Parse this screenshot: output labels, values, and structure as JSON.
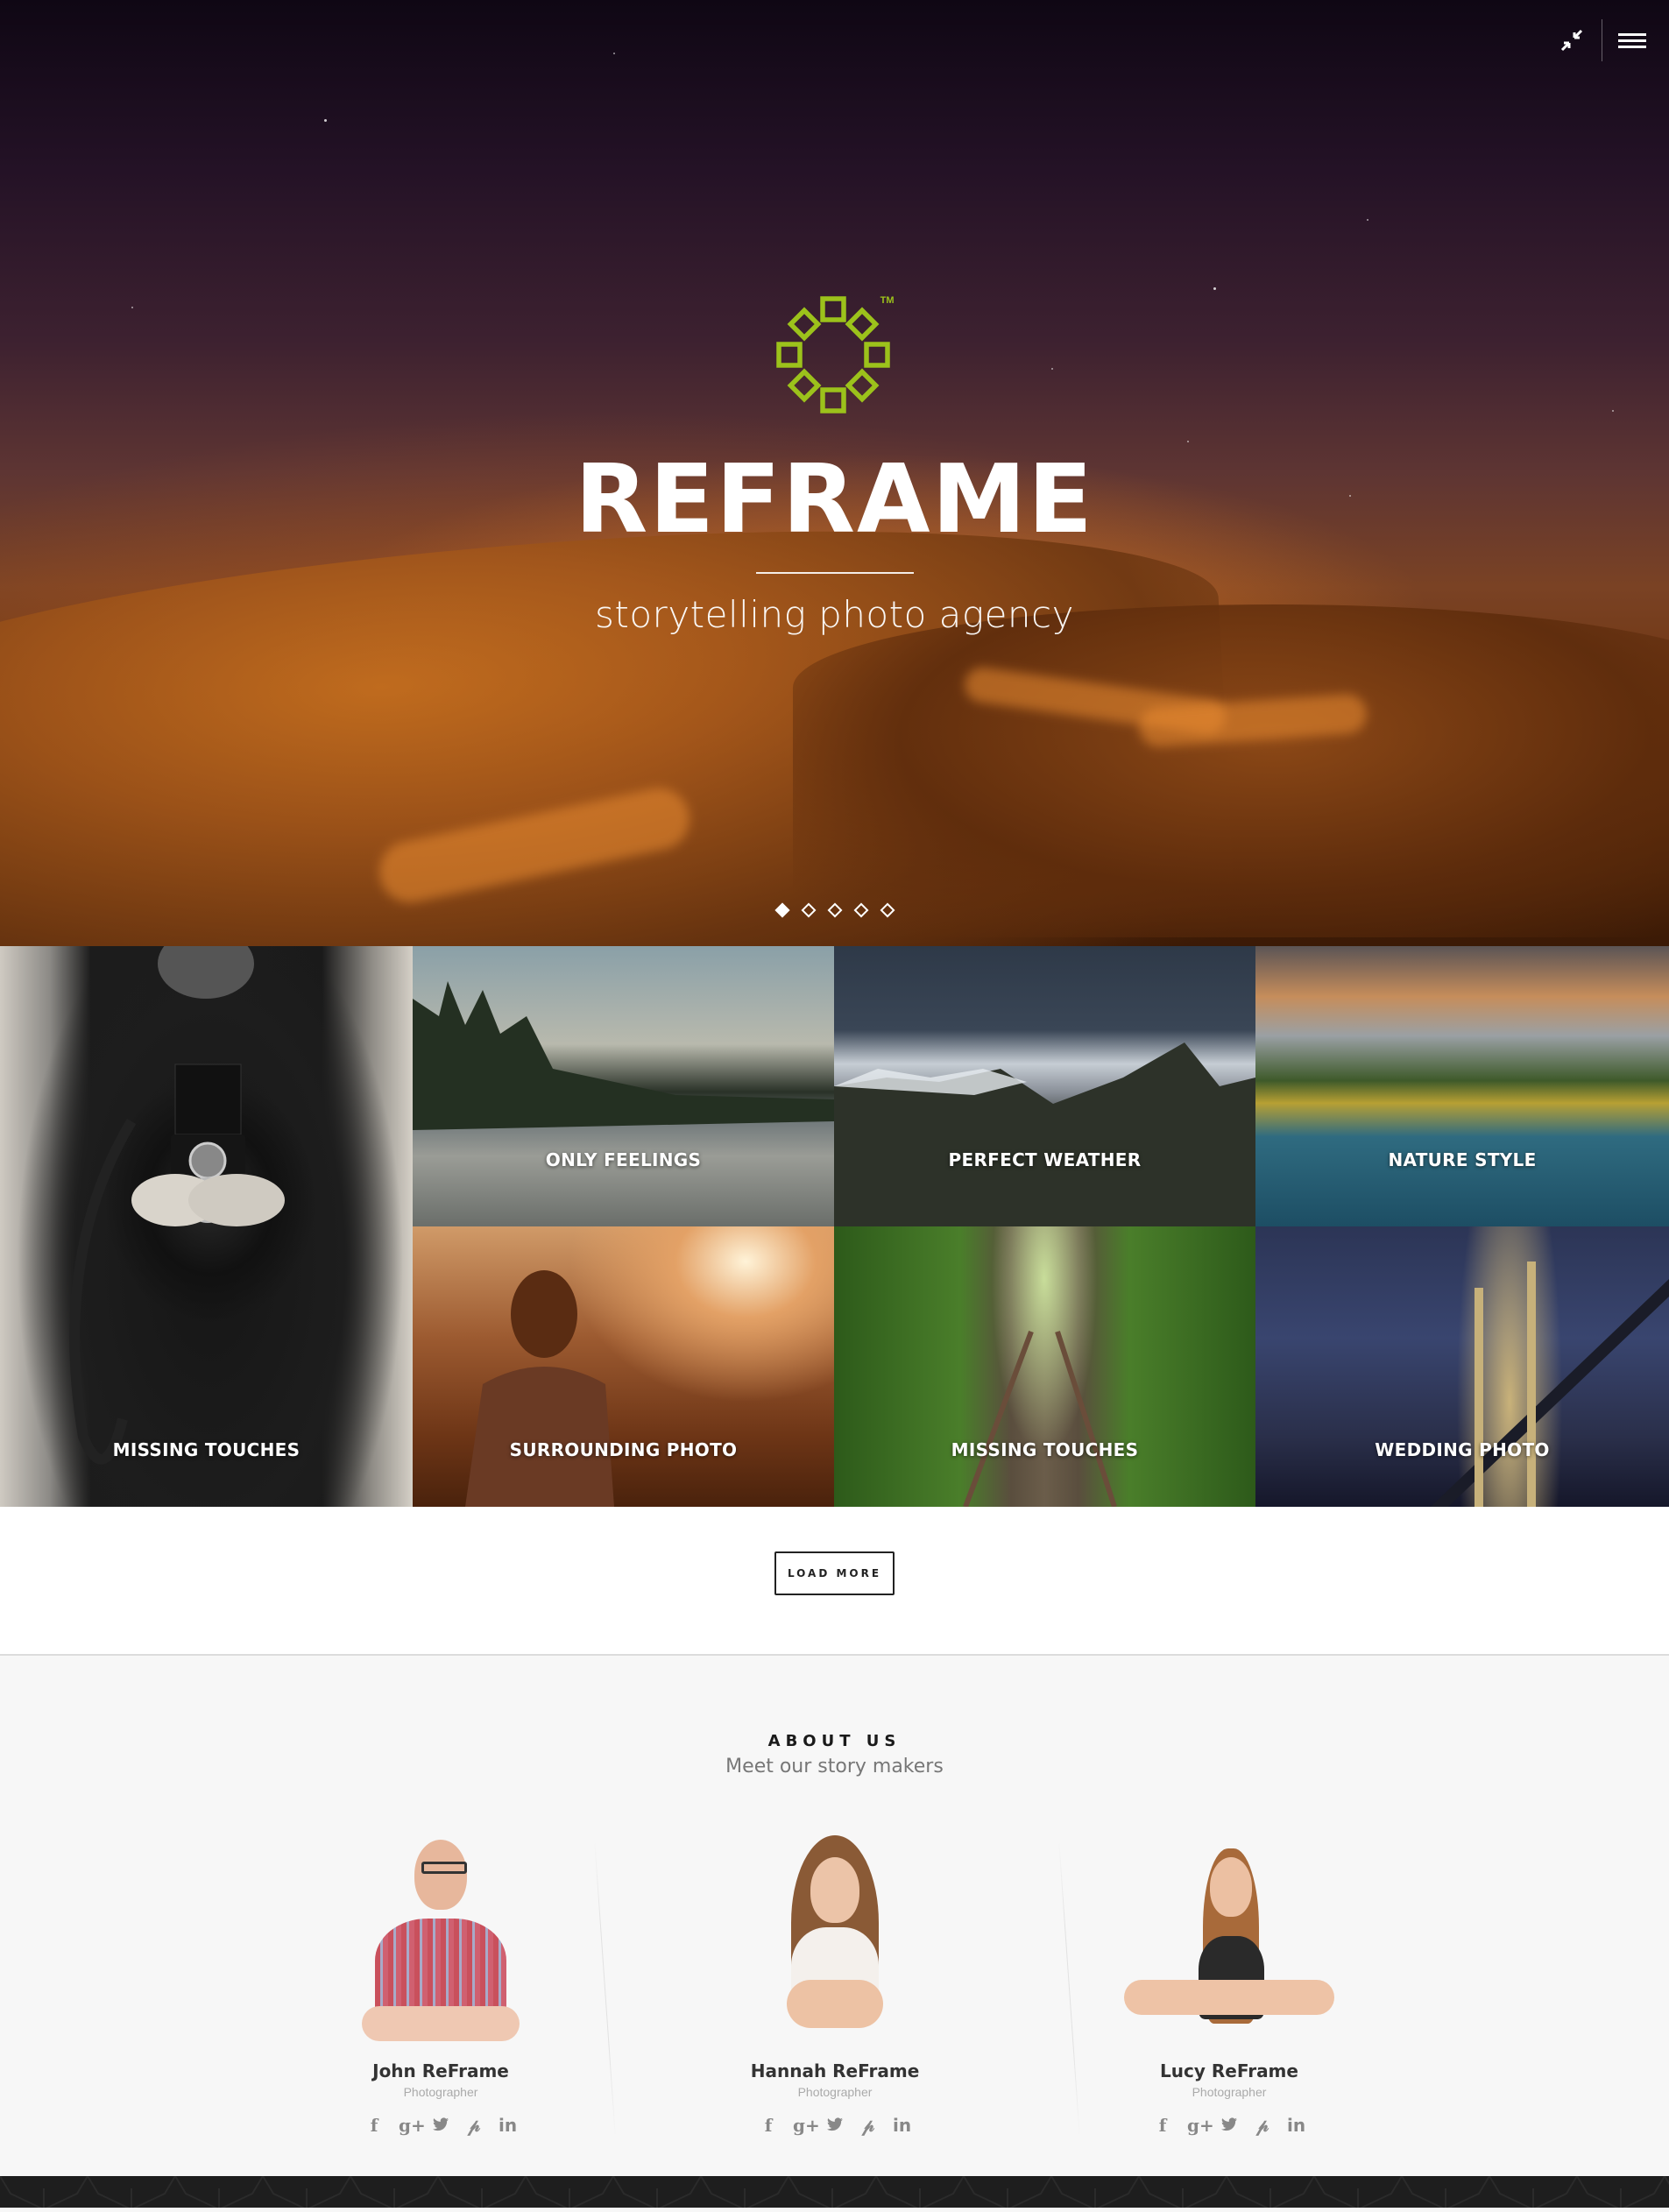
{
  "hero": {
    "brand_title": "REFRAME",
    "tagline": "storytelling photo agency",
    "logo_mark": "TM",
    "accent_color": "#9cc21b",
    "tools": {
      "collapse_icon": "collapse-arrows-icon",
      "menu_icon": "hamburger-menu-icon"
    },
    "slider": {
      "slide_count": 5,
      "active_index": 0
    }
  },
  "gallery": {
    "tiles": [
      {
        "caption": "MISSING TOUCHES"
      },
      {
        "caption": "ONLY FEELINGS"
      },
      {
        "caption": "PERFECT WEATHER"
      },
      {
        "caption": "NATURE STYLE"
      },
      {
        "caption": "SURROUNDING PHOTO"
      },
      {
        "caption": "MISSING TOUCHES"
      },
      {
        "caption": "WEDDING PHOTO"
      }
    ]
  },
  "load_more": {
    "label": "LOAD MORE"
  },
  "about": {
    "title": "ABOUT US",
    "subtitle": "Meet our story makers",
    "members": [
      {
        "name": "John ReFrame",
        "role": "Photographer"
      },
      {
        "name": "Hannah ReFrame",
        "role": "Photographer"
      },
      {
        "name": "Lucy ReFrame",
        "role": "Photographer"
      }
    ],
    "social_icons": [
      {
        "icon": "facebook-icon",
        "glyph": "f"
      },
      {
        "icon": "google-plus-icon",
        "glyph": "g+"
      },
      {
        "icon": "twitter-icon",
        "glyph": "🐦"
      },
      {
        "icon": "pinterest-icon",
        "glyph": "P"
      },
      {
        "icon": "linkedin-icon",
        "glyph": "in"
      }
    ]
  }
}
